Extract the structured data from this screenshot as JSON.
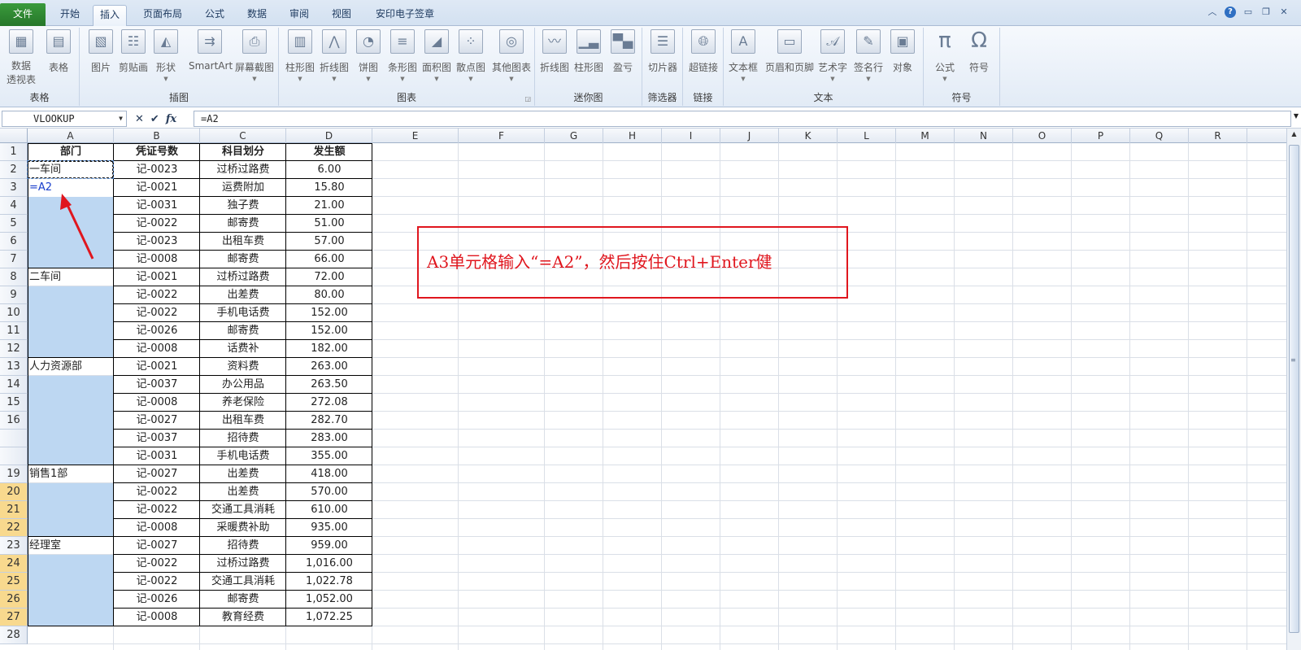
{
  "tabs": {
    "file": "文件",
    "home": "开始",
    "insert": "插入",
    "page_layout": "页面布局",
    "formulas": "公式",
    "data": "数据",
    "review": "审阅",
    "view": "视图",
    "anyin": "安印电子签章"
  },
  "ribbon": {
    "groups": {
      "tables": "表格",
      "illustrations": "插图",
      "charts": "图表",
      "sparklines": "迷你图",
      "filter": "筛选器",
      "links": "链接",
      "text": "文本",
      "symbols": "符号"
    },
    "buttons": {
      "pivot_line1": "数据",
      "pivot_line2": "透视表",
      "table": "表格",
      "picture": "图片",
      "clipart": "剪贴画",
      "shapes": "形状",
      "smartart": "SmartArt",
      "screenshot": "屏幕截图",
      "column_chart": "柱形图",
      "line_chart": "折线图",
      "pie_chart": "饼图",
      "bar_chart": "条形图",
      "area_chart": "面积图",
      "scatter_chart": "散点图",
      "other_charts": "其他图表",
      "spark_line": "折线图",
      "spark_column": "柱形图",
      "spark_winloss": "盈亏",
      "slicer": "切片器",
      "hyperlink": "超链接",
      "textbox": "文本框",
      "header_footer": "页眉和页脚",
      "wordart": "艺术字",
      "signature_line": "签名行",
      "object": "对象",
      "equation": "公式",
      "symbol": "符号"
    }
  },
  "formula_bar": {
    "name_box": "VLOOKUP",
    "formula": "=A2"
  },
  "columns": [
    "A",
    "B",
    "C",
    "D",
    "E",
    "F",
    "G",
    "H",
    "I",
    "J",
    "K",
    "L",
    "M",
    "N",
    "O",
    "P",
    "Q",
    "R"
  ],
  "row_numbers": [
    "1",
    "2",
    "3",
    "4",
    "5",
    "6",
    "7",
    "8",
    "9",
    "10",
    "11",
    "12",
    "13",
    "14",
    "15",
    "16",
    "",
    "",
    "19",
    "20",
    "21",
    "22",
    "23",
    "24",
    "25",
    "26",
    "27",
    "28"
  ],
  "headers": {
    "dept": "部门",
    "voucher": "凭证号数",
    "subject": "科目划分",
    "amount": "发生额"
  },
  "rows": [
    {
      "dept": "一车间",
      "voucher": "记-0023",
      "subject": "过桥过路费",
      "amount": "6.00"
    },
    {
      "dept": "=A2",
      "voucher": "记-0021",
      "subject": "运费附加",
      "amount": "15.80"
    },
    {
      "dept": "",
      "voucher": "记-0031",
      "subject": "独子费",
      "amount": "21.00"
    },
    {
      "dept": "",
      "voucher": "记-0022",
      "subject": "邮寄费",
      "amount": "51.00"
    },
    {
      "dept": "",
      "voucher": "记-0023",
      "subject": "出租车费",
      "amount": "57.00"
    },
    {
      "dept": "",
      "voucher": "记-0008",
      "subject": "邮寄费",
      "amount": "66.00"
    },
    {
      "dept": "二车间",
      "voucher": "记-0021",
      "subject": "过桥过路费",
      "amount": "72.00"
    },
    {
      "dept": "",
      "voucher": "记-0022",
      "subject": "出差费",
      "amount": "80.00"
    },
    {
      "dept": "",
      "voucher": "记-0022",
      "subject": "手机电话费",
      "amount": "152.00"
    },
    {
      "dept": "",
      "voucher": "记-0026",
      "subject": "邮寄费",
      "amount": "152.00"
    },
    {
      "dept": "",
      "voucher": "记-0008",
      "subject": "话费补",
      "amount": "182.00"
    },
    {
      "dept": "人力资源部",
      "voucher": "记-0021",
      "subject": "资料费",
      "amount": "263.00"
    },
    {
      "dept": "",
      "voucher": "记-0037",
      "subject": "办公用品",
      "amount": "263.50"
    },
    {
      "dept": "",
      "voucher": "记-0008",
      "subject": "养老保险",
      "amount": "272.08"
    },
    {
      "dept": "",
      "voucher": "记-0027",
      "subject": "出租车费",
      "amount": "282.70"
    },
    {
      "dept": "",
      "voucher": "记-0037",
      "subject": "招待费",
      "amount": "283.00"
    },
    {
      "dept": "",
      "voucher": "记-0031",
      "subject": "手机电话费",
      "amount": "355.00"
    },
    {
      "dept": "销售1部",
      "voucher": "记-0027",
      "subject": "出差费",
      "amount": "418.00"
    },
    {
      "dept": "",
      "voucher": "记-0022",
      "subject": "出差费",
      "amount": "570.00"
    },
    {
      "dept": "",
      "voucher": "记-0022",
      "subject": "交通工具消耗",
      "amount": "610.00"
    },
    {
      "dept": "",
      "voucher": "记-0008",
      "subject": "采暖费补助",
      "amount": "935.00"
    },
    {
      "dept": "经理室",
      "voucher": "记-0027",
      "subject": "招待费",
      "amount": "959.00"
    },
    {
      "dept": "",
      "voucher": "记-0022",
      "subject": "过桥过路费",
      "amount": "1,016.00"
    },
    {
      "dept": "",
      "voucher": "记-0022",
      "subject": "交通工具消耗",
      "amount": "1,022.78"
    },
    {
      "dept": "",
      "voucher": "记-0026",
      "subject": "邮寄费",
      "amount": "1,052.00"
    },
    {
      "dept": "",
      "voucher": "记-0008",
      "subject": "教育经费",
      "amount": "1,072.25"
    }
  ],
  "annotation": "A3单元格输入“=A2”，然后按住Ctrl+Enter健",
  "colors": {
    "selection": "#bdd7f2",
    "annotation": "#e0161e",
    "row_header_highlight": "#f8d98e",
    "file_tab": "#2f8a33"
  }
}
